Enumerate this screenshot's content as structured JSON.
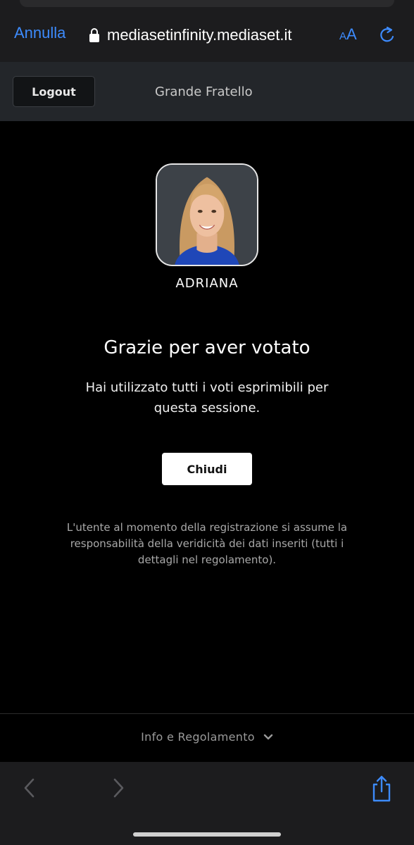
{
  "browser": {
    "cancel_label": "Annulla",
    "url": "mediasetinfinity.mediaset.it",
    "text_size_small": "A",
    "text_size_big": "A",
    "lock_icon": "lock-icon",
    "reload_icon": "reload-icon",
    "back_icon": "chevron-left-icon",
    "forward_icon": "chevron-right-icon",
    "share_icon": "share-icon",
    "accent_color": "#3d8bfd"
  },
  "header": {
    "logout_label": "Logout",
    "show_title": "Grande Fratello"
  },
  "vote": {
    "candidate_name": "ADRIANA",
    "thanks_title": "Grazie per aver votato",
    "message": "Hai utilizzato tutti i voti esprimibili per questa sessione.",
    "close_label": "Chiudi",
    "disclaimer": "L'utente al momento della registrazione si assume la responsabilità della veridicità dei dati inseriti (tutti i dettagli nel regolamento)."
  },
  "footer": {
    "info_label": "Info e Regolamento",
    "chevron_icon": "chevron-down-icon"
  }
}
